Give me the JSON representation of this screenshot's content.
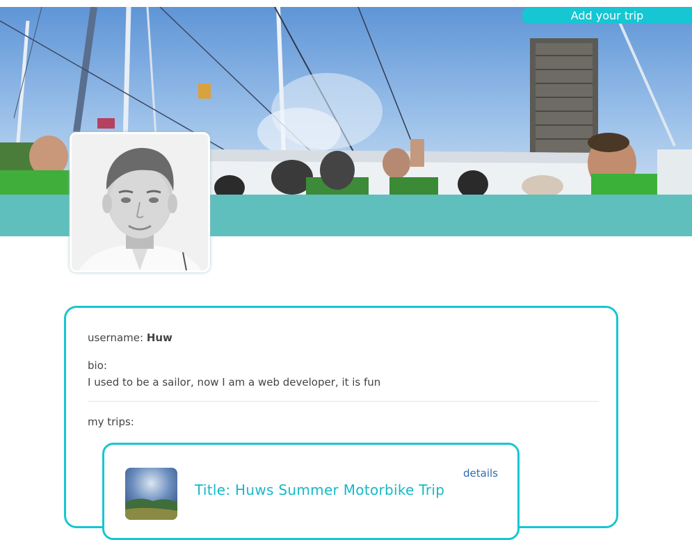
{
  "header": {
    "add_trip_label": "Add your trip"
  },
  "profile": {
    "username_label": "username: ",
    "username": "Huw",
    "bio_label": "bio:",
    "bio": "I used to be a sailor, now I am a web developer, it is fun",
    "trips_label": "my trips:"
  },
  "trips": [
    {
      "title": "Title: Huws Summer Motorbike Trip",
      "details_label": "details"
    }
  ],
  "colors": {
    "accent": "#16c6d2",
    "band": "#5fbfbd",
    "link": "#2f6bb8",
    "trip_title": "#16b8c6"
  }
}
